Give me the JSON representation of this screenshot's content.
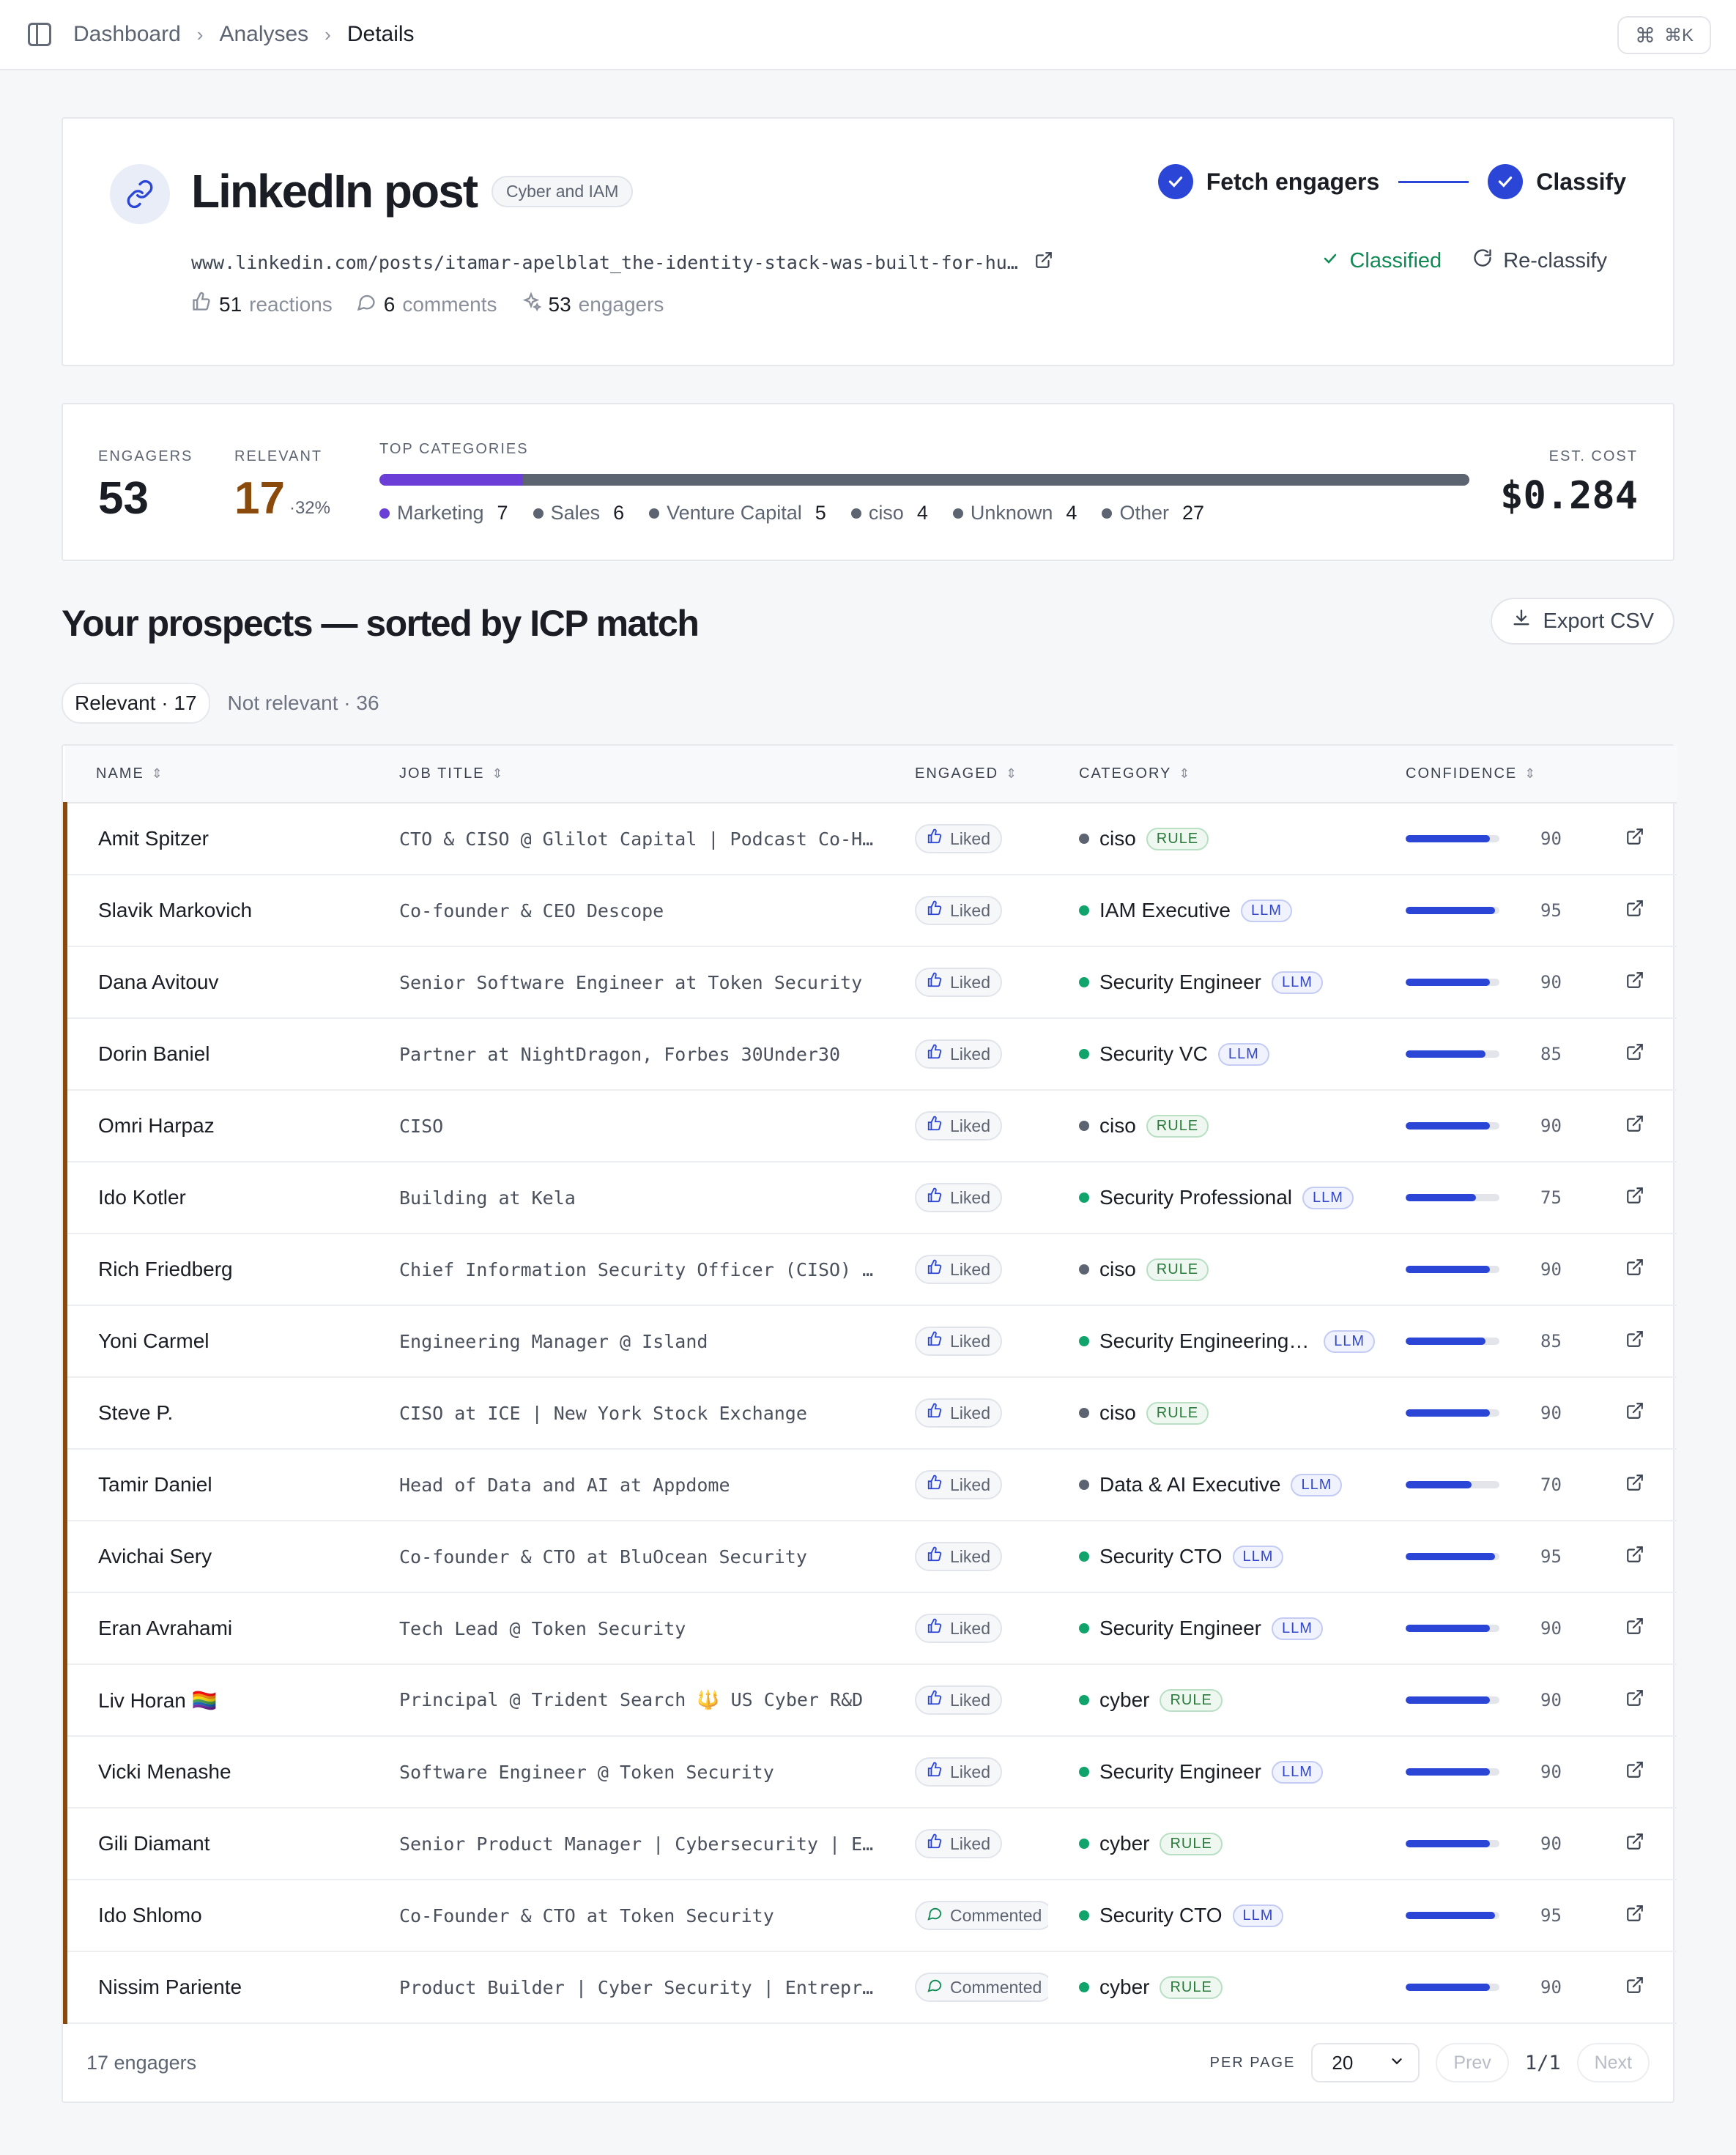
{
  "breadcrumb": [
    "Dashboard",
    "Analyses",
    "Details"
  ],
  "shortcut": "⌘K",
  "post": {
    "title": "LinkedIn post",
    "tag": "Cyber and IAM",
    "url": "www.linkedin.com/posts/itamar-apelblat_the-identity-stack-was-built-for-hu…",
    "reactions": "51",
    "reactions_label": "reactions",
    "comments": "6",
    "comments_label": "comments",
    "engagers": "53",
    "engagers_label": "engagers"
  },
  "steps": [
    {
      "label": "Fetch engagers"
    },
    {
      "label": "Classify"
    }
  ],
  "status": {
    "classified": "Classified",
    "reclassify": "Re-classify"
  },
  "metrics": {
    "engagers_label": "ENGAGERS",
    "engagers": "53",
    "relevant_label": "RELEVANT",
    "relevant": "17",
    "relevant_pct": "·32%",
    "top_categories_label": "TOP CATEGORIES",
    "marketing_share": 0.132,
    "categories": [
      {
        "name": "Marketing",
        "count": "7",
        "color": "#6b3ed8"
      },
      {
        "name": "Sales",
        "count": "6",
        "color": "#5d6471"
      },
      {
        "name": "Venture Capital",
        "count": "5",
        "color": "#5d6471"
      },
      {
        "name": "ciso",
        "count": "4",
        "color": "#5d6471"
      },
      {
        "name": "Unknown",
        "count": "4",
        "color": "#5d6471"
      },
      {
        "name": "Other",
        "count": "27",
        "color": "#5d6471"
      }
    ],
    "cost_label": "EST. COST",
    "cost": "$0.284"
  },
  "prospects": {
    "title": "Your prospects — sorted by ICP match",
    "export_label": "Export CSV",
    "tabs": [
      "Relevant · 17",
      "Not relevant · 36"
    ],
    "columns": [
      "NAME",
      "JOB TITLE",
      "ENGAGED",
      "CATEGORY",
      "CONFIDENCE"
    ],
    "rows": [
      {
        "name": "Amit Spitzer",
        "title": "CTO & CISO @ Glilot Capital | Podcast Co-Host",
        "engaged": "Liked",
        "category": "ciso",
        "color": "#5d6471",
        "src": "RULE",
        "conf": "90"
      },
      {
        "name": "Slavik Markovich",
        "title": "Co-founder & CEO Descope",
        "engaged": "Liked",
        "category": "IAM Executive",
        "color": "#10a36b",
        "src": "LLM",
        "conf": "95"
      },
      {
        "name": "Dana Avitouv",
        "title": "Senior Software Engineer at Token Security",
        "engaged": "Liked",
        "category": "Security Engineer",
        "color": "#10a36b",
        "src": "LLM",
        "conf": "90"
      },
      {
        "name": "Dorin Baniel",
        "title": "Partner at NightDragon, Forbes 30Under30",
        "engaged": "Liked",
        "category": "Security VC",
        "color": "#10a36b",
        "src": "LLM",
        "conf": "85"
      },
      {
        "name": "Omri Harpaz",
        "title": "CISO",
        "engaged": "Liked",
        "category": "ciso",
        "color": "#5d6471",
        "src": "RULE",
        "conf": "90"
      },
      {
        "name": "Ido Kotler",
        "title": "Building at Kela",
        "engaged": "Liked",
        "category": "Security Professional",
        "color": "#10a36b",
        "src": "LLM",
        "conf": "75"
      },
      {
        "name": "Rich Friedberg",
        "title": "Chief Information Security Officer (CISO) …",
        "engaged": "Liked",
        "category": "ciso",
        "color": "#5d6471",
        "src": "RULE",
        "conf": "90"
      },
      {
        "name": "Yoni Carmel",
        "title": "Engineering Manager @ Island",
        "engaged": "Liked",
        "category": "Security Engineering M…",
        "color": "#10a36b",
        "src": "LLM",
        "conf": "85"
      },
      {
        "name": "Steve P.",
        "title": "CISO at ICE | New York Stock Exchange",
        "engaged": "Liked",
        "category": "ciso",
        "color": "#5d6471",
        "src": "RULE",
        "conf": "90"
      },
      {
        "name": "Tamir Daniel",
        "title": "Head of Data and AI at Appdome",
        "engaged": "Liked",
        "category": "Data & AI Executive",
        "color": "#5d6471",
        "src": "LLM",
        "conf": "70"
      },
      {
        "name": "Avichai Sery",
        "title": "Co-founder & CTO at BluOcean Security",
        "engaged": "Liked",
        "category": "Security CTO",
        "color": "#10a36b",
        "src": "LLM",
        "conf": "95"
      },
      {
        "name": "Eran Avrahami",
        "title": "Tech Lead @ Token Security",
        "engaged": "Liked",
        "category": "Security Engineer",
        "color": "#10a36b",
        "src": "LLM",
        "conf": "90"
      },
      {
        "name": "Liv Horan 🏳️‍🌈",
        "title": "Principal @ Trident Search 🔱 US Cyber R&D",
        "engaged": "Liked",
        "category": "cyber",
        "color": "#10a36b",
        "src": "RULE",
        "conf": "90"
      },
      {
        "name": "Vicki Menashe",
        "title": "Software Engineer @ Token Security",
        "engaged": "Liked",
        "category": "Security Engineer",
        "color": "#10a36b",
        "src": "LLM",
        "conf": "90"
      },
      {
        "name": "Gili Diamant",
        "title": "Senior Product Manager | Cybersecurity | E…",
        "engaged": "Liked",
        "category": "cyber",
        "color": "#10a36b",
        "src": "RULE",
        "conf": "90"
      },
      {
        "name": "Ido Shlomo",
        "title": "Co-Founder & CTO at Token Security",
        "engaged": "Commented",
        "category": "Security CTO",
        "color": "#10a36b",
        "src": "LLM",
        "conf": "95"
      },
      {
        "name": "Nissim Pariente",
        "title": "Product Builder | Cyber Security | Entrepr…",
        "engaged": "Commented",
        "category": "cyber",
        "color": "#10a36b",
        "src": "RULE",
        "conf": "90"
      }
    ],
    "footer_count": "17 engagers",
    "per_page_label": "PER PAGE",
    "per_page": "20",
    "prev": "Prev",
    "page_info": "1/1",
    "next": "Next"
  }
}
